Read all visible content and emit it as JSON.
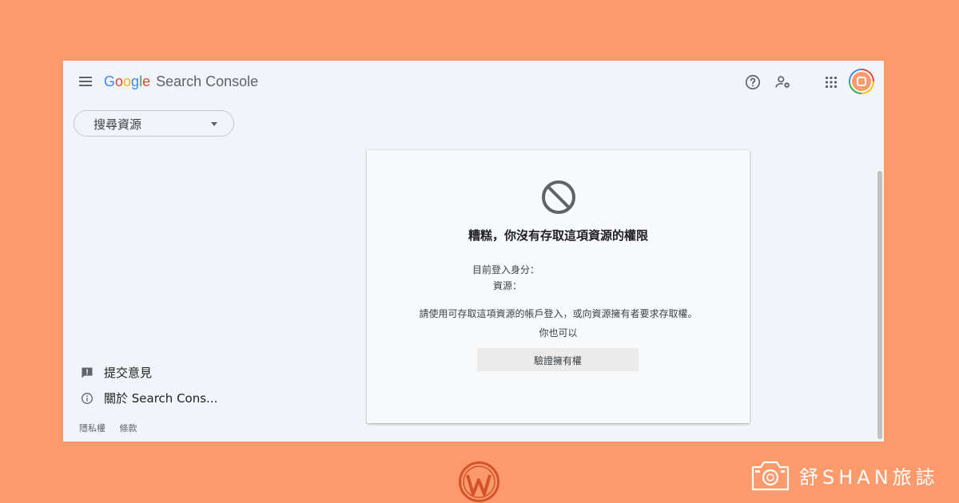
{
  "header": {
    "logo": {
      "g1": "G",
      "o1": "o",
      "o2": "o",
      "g2": "g",
      "l": "l",
      "e": "e",
      "product": "Search Console"
    },
    "icons": [
      "menu-icon",
      "help-icon",
      "manage-users-icon",
      "apps-grid-icon",
      "account-avatar"
    ]
  },
  "sidebar": {
    "property_select": "搜尋資源",
    "feedback": "提交意見",
    "about": "關於 Search Cons...",
    "privacy": "隱私權",
    "terms": "條款"
  },
  "card": {
    "title": "糟糕，你沒有存取這項資源的權限",
    "current_user_label": "目前登入身分：",
    "property_label": "資源：",
    "description": "請使用可存取這項資源的帳戶登入，或向資源擁有者要求存取權。",
    "also": "你也可以",
    "verify_button": "驗證擁有權"
  },
  "watermark": {
    "brand_text": "舒SHAN旅誌"
  },
  "colors": {
    "background": "#fc9a6c",
    "window": "#f1f4f9",
    "card": "#f8f9fa",
    "google_blue": "#4285f4",
    "google_red": "#ea4335",
    "google_yellow": "#fbbc05",
    "google_green": "#34a853"
  }
}
